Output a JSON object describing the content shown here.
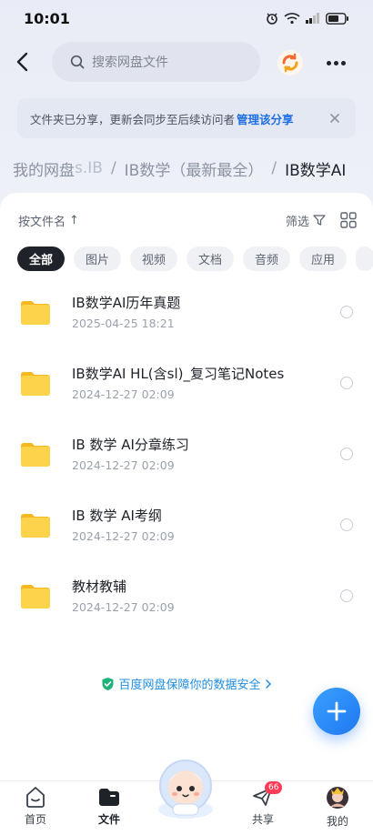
{
  "status_bar": {
    "time": "10:01"
  },
  "search": {
    "placeholder": "搜索网盘文件"
  },
  "banner": {
    "text": "文件夹已分享，更新会同步至后续访问者",
    "link": "管理该分享"
  },
  "breadcrumb": {
    "home": "我的网盘",
    "partial": "s.IB",
    "parent": "IB数学（最新最全）",
    "separator": "/",
    "current": "IB数学AI"
  },
  "toolbar": {
    "sort_label": "按文件名",
    "sort_arrow": "↑",
    "filter_label": "筛选"
  },
  "chips": [
    {
      "label": "全部",
      "active": true
    },
    {
      "label": "图片",
      "active": false
    },
    {
      "label": "视频",
      "active": false
    },
    {
      "label": "文档",
      "active": false
    },
    {
      "label": "音频",
      "active": false
    },
    {
      "label": "应用",
      "active": false
    }
  ],
  "files": [
    {
      "name": "IB数学AI历年真题",
      "date": "2025-04-25  18:21"
    },
    {
      "name": "IB数学AI HL(含sl)_复习笔记Notes",
      "date": "2024-12-27  02:09"
    },
    {
      "name": "IB 数学 AI分章练习",
      "date": "2024-12-27  02:09"
    },
    {
      "name": "IB 数学 AI考纲",
      "date": "2024-12-27  02:09"
    },
    {
      "name": "教材教辅",
      "date": "2024-12-27  02:09"
    }
  ],
  "safety_note": "百度网盘保障你的数据安全",
  "tabs": [
    {
      "label": "首页",
      "active": false
    },
    {
      "label": "文件",
      "active": true
    },
    {
      "label": "共享",
      "active": false,
      "badge": "66"
    },
    {
      "label": "我的",
      "active": false
    }
  ],
  "colors": {
    "accent": "#1f78f0",
    "folder": "#f9c532",
    "badge": "#ff3b57"
  }
}
